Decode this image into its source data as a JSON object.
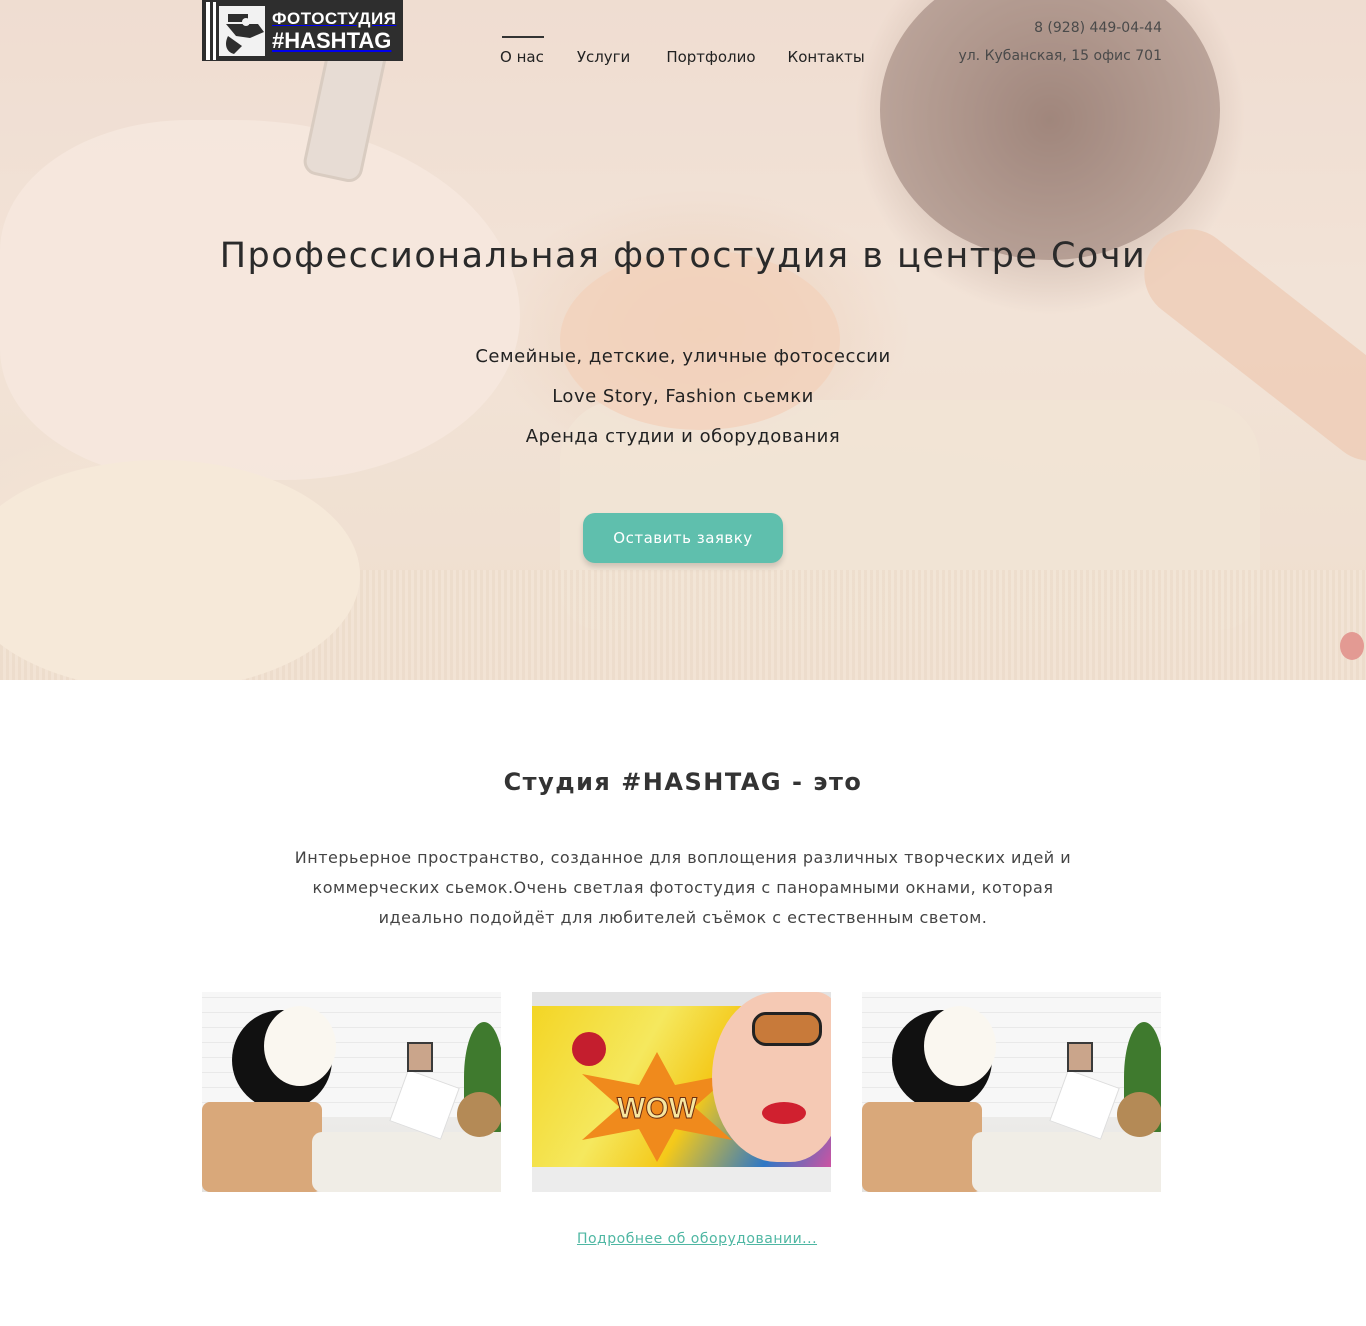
{
  "header": {
    "logo": {
      "line1": "ФОТОСТУДИЯ",
      "line2": "#HASHTAG"
    },
    "nav": [
      {
        "label": "О нас",
        "active": true
      },
      {
        "label": "Услуги",
        "active": false
      },
      {
        "label": "Портфолио",
        "active": false
      },
      {
        "label": "Контакты",
        "active": false
      }
    ],
    "phone": "8 (928) 449-04-44",
    "address": "ул. Кубанская, 15 офис 701"
  },
  "hero": {
    "title": "Профессиональная фотостудия в центре Сочи",
    "lines": [
      "Семейные, детские, уличные фотосессии",
      "Love Story, Fashion сьемки",
      "Аренда студии и оборудования"
    ],
    "cta_label": "Оставить заявку"
  },
  "about": {
    "title": "Студия #HASHTAG - это",
    "text": "Интерьерное пространство, созданное для воплощения различных творческих идей и коммерческих сьемок.Очень светлая фотостудия с панорамными окнами, которая идеально подойдёт для любителей съёмок с естественным светом.",
    "more_link": "Подробнее об оборудовании..."
  },
  "colors": {
    "accent": "#5fbfad",
    "link": "#4fb7a3",
    "logo_bg": "#2e2e2e"
  }
}
